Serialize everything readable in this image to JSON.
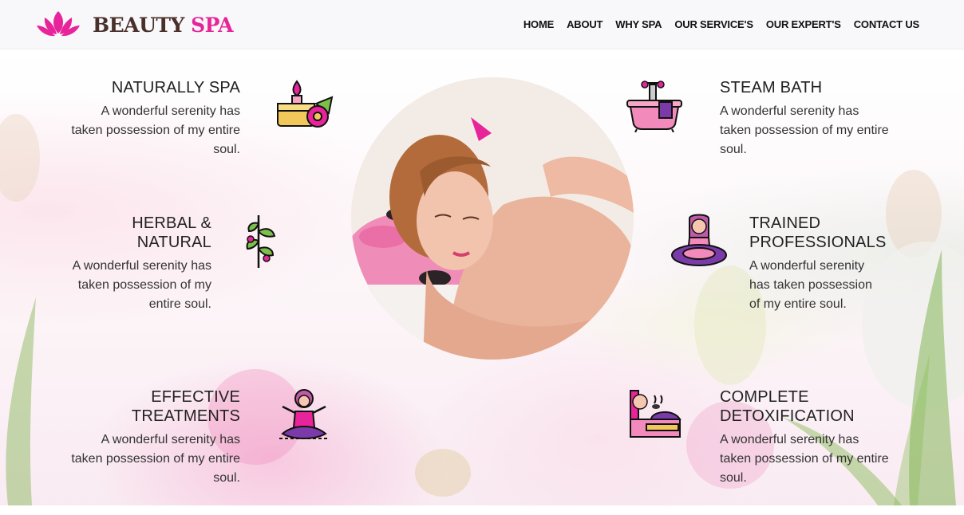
{
  "brand": {
    "name_part1": "BEAUTY",
    "name_part2": "SPA",
    "accent": "#e8249a",
    "dark": "#4a2f2a"
  },
  "nav": {
    "items": [
      {
        "label": "HOME"
      },
      {
        "label": "ABOUT"
      },
      {
        "label": "WHY SPA"
      },
      {
        "label": "OUR SERVICE'S"
      },
      {
        "label": "OUR EXPERT'S"
      },
      {
        "label": "CONTACT US"
      }
    ]
  },
  "features": {
    "naturally_spa": {
      "title": "NATURALLY SPA",
      "text": "A wonderful serenity has taken possession of my entire soul.",
      "icon": "candle-flower-icon"
    },
    "herbal_natural": {
      "title": "HERBAL & NATURAL",
      "text": "A wonderful serenity has taken possession of my entire soul.",
      "icon": "herb-branch-icon"
    },
    "effective_treatments": {
      "title": "EFFECTIVE TREATMENTS",
      "text": "A wonderful serenity has taken possession of my entire soul.",
      "icon": "meditation-woman-icon"
    },
    "steam_bath": {
      "title": "STEAM BATH",
      "text": "A wonderful serenity has taken possession of my entire soul.",
      "icon": "bathtub-icon"
    },
    "trained_professionals": {
      "title": "TRAINED PROFESSIONALS",
      "text": "A wonderful serenity has taken possession of my entire soul.",
      "icon": "yoga-woman-icon"
    },
    "complete_detox": {
      "title": "COMPLETE DETOXIFICATION",
      "text": "A wonderful serenity has taken possession of my entire soul.",
      "icon": "hot-stone-massage-icon"
    }
  }
}
